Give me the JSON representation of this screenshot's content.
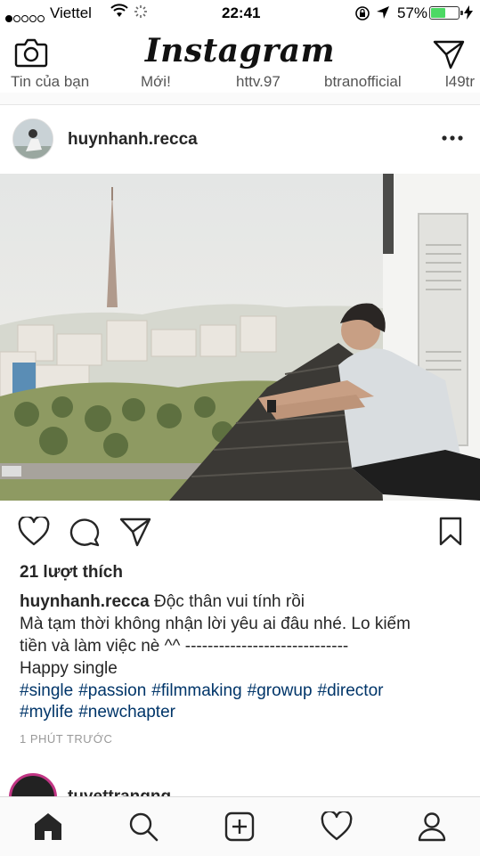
{
  "status_bar": {
    "carrier": "Viettel",
    "time": "22:41",
    "battery_percent": "57%",
    "battery_level": 0.57,
    "signal_bars_filled": 1,
    "signal_bars_total": 5
  },
  "header": {
    "title": "Instagram",
    "left_icon": "camera-icon",
    "right_icon": "direct-message-icon"
  },
  "stories": {
    "items": [
      "Tin của bạn",
      "Mới!",
      "httv.97",
      "btranofficial",
      "l49tr"
    ]
  },
  "post": {
    "username": "huynhanh.recca",
    "likes": "21 lượt thích",
    "caption_user": "huynhanh.recca",
    "caption_line1": "Độc thân vui tính rồi",
    "caption_line2": "Mà tạm thời không nhận lời yêu ai đâu nhé. Lo kiếm",
    "caption_line3": "tiền và làm việc nè ^^ -----------------------------",
    "caption_line4": "Happy single",
    "hashtags": [
      "#single",
      "#passion",
      "#filmmaking",
      "#growup",
      "#director",
      "#mylife",
      "#newchapter"
    ],
    "timestamp": "1 PHÚT TRƯỚC"
  },
  "next_post": {
    "username": "tuyettrangng"
  },
  "tab_bar": {
    "items": [
      "home-icon",
      "search-icon",
      "add-icon",
      "activity-icon",
      "profile-icon"
    ]
  },
  "colors": {
    "hashtag": "#003569",
    "battery": "#4cd964",
    "story_ring": "#c13584"
  }
}
